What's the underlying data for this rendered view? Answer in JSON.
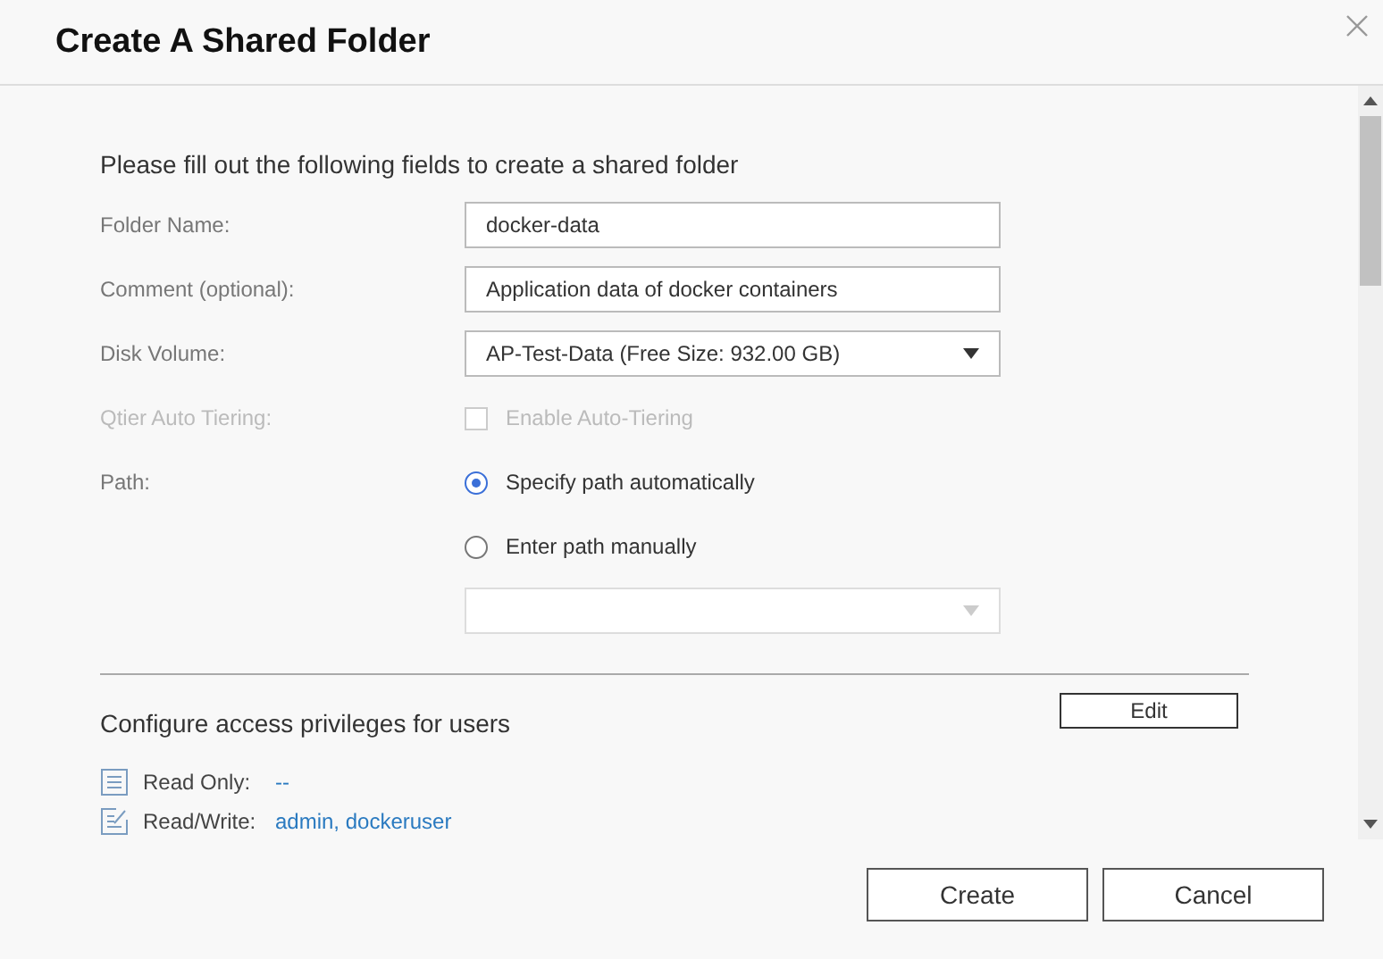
{
  "window": {
    "title": "Create A Shared Folder"
  },
  "form": {
    "heading": "Please fill out the following fields to create a shared folder",
    "rows": [
      {
        "kind": "text",
        "label": "Folder Name:",
        "value": "docker-data"
      },
      {
        "kind": "text",
        "label": "Comment (optional):",
        "value": "Application data of docker containers"
      },
      {
        "kind": "select",
        "label": "Disk Volume:",
        "value": "AP-Test-Data (Free Size: 932.00 GB)"
      },
      {
        "kind": "checkbox",
        "label": "Qtier Auto Tiering:",
        "option": "Enable Auto-Tiering",
        "checked": false,
        "disabled": true
      }
    ],
    "path": {
      "label": "Path:",
      "options": [
        {
          "label": "Specify path automatically",
          "selected": true
        },
        {
          "label": "Enter path manually",
          "selected": false
        }
      ],
      "select_disabled": true
    }
  },
  "privileges": {
    "heading": "Configure access privileges for users",
    "edit_button": "Edit",
    "entries": [
      {
        "kind": "read",
        "label": "Read Only:",
        "users": "--"
      },
      {
        "kind": "write",
        "label": "Read/Write:",
        "users": "admin, dockeruser"
      }
    ]
  },
  "buttons": [
    "Create",
    "Cancel"
  ]
}
